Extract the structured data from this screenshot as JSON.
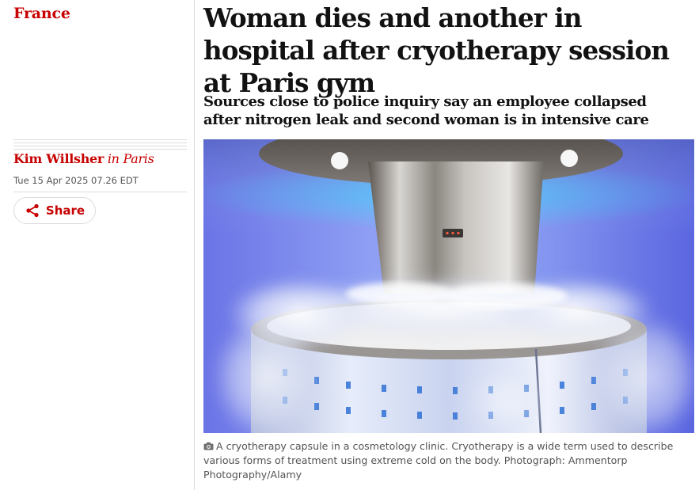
{
  "section": {
    "label": "France"
  },
  "byline": {
    "author": "Kim Willsher",
    "location": "in Paris"
  },
  "dateline": "Tue 15 Apr 2025 07.26 EDT",
  "share": {
    "label": "Share",
    "icon": "share-icon"
  },
  "headline": "Woman dies and another in hospital after cryotherapy session at Paris gym",
  "standfirst": "Sources close to police inquiry say an employee collapsed after nitrogen leak and second woman is in intensive care",
  "figure": {
    "caption": "A cryotherapy capsule in a cosmetology clinic. Cryotherapy is a wide term used to describe various forms of treatment using extreme cold on the body. Photograph: Ammentorp Photography/Alamy",
    "caption_icon": "camera-icon"
  },
  "colors": {
    "accent": "#c70000",
    "text": "#121212",
    "muted": "#545454",
    "rule": "#dcdcdc"
  }
}
